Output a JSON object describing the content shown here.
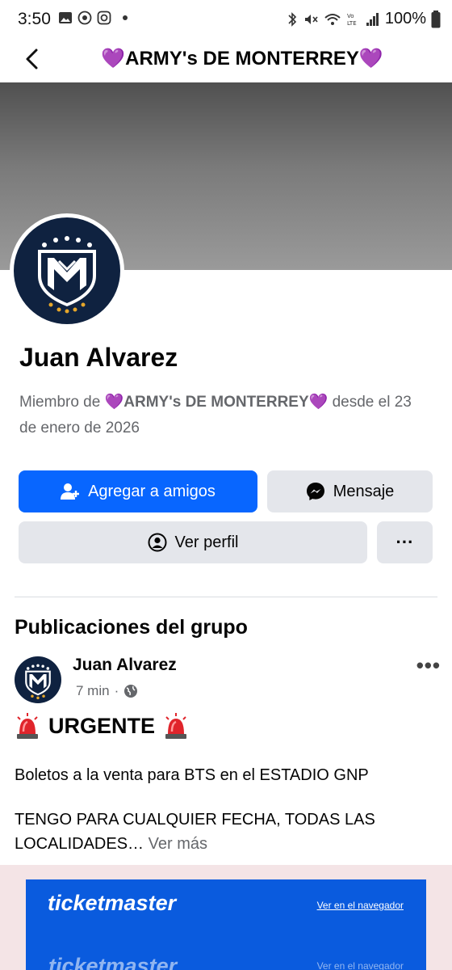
{
  "status_bar": {
    "time": "3:50",
    "battery": "100%"
  },
  "header": {
    "title": "💜ARMY's DE MONTERREY💜"
  },
  "profile": {
    "name": "Juan Alvarez",
    "member_prefix": "Miembro de ",
    "group_name": "💜ARMY's DE MONTERREY💜",
    "member_suffix": " desde el 23 de enero de 2026"
  },
  "actions": {
    "add_friend": "Agregar a amigos",
    "message": "Mensaje",
    "view_profile": "Ver perfil",
    "more": "···"
  },
  "posts_section": {
    "title": "Publicaciones del grupo"
  },
  "post": {
    "author": "Juan Alvarez",
    "time": "7 min",
    "separator": "·",
    "urgent_label": "URGENTE",
    "line1": "Boletos a la venta para BTS en el ESTADIO GNP",
    "line2": "TENGO PARA CUALQUIER FECHA, TODAS LAS LOCALIDADES…",
    "see_more": "Ver más",
    "more": "•••"
  },
  "embed": {
    "brand": "ticketmaster",
    "link": "Ver en el navegador"
  },
  "colors": {
    "primary": "#0866ff",
    "secondary": "#e4e6eb",
    "ticketmaster": "#0a5bde",
    "crest": "#0f2240"
  }
}
